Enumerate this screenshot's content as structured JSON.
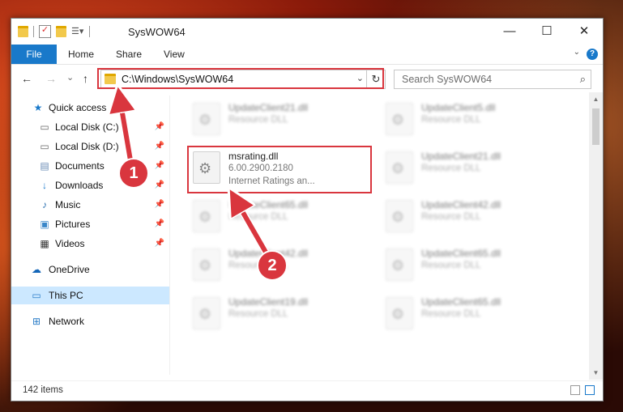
{
  "window": {
    "title": "SysWOW64",
    "minimize_glyph": "—",
    "maximize_glyph": "☐",
    "close_glyph": "✕"
  },
  "ribbon": {
    "tabs": [
      "File",
      "Home",
      "Share",
      "View"
    ],
    "help_glyph": "?"
  },
  "navbar": {
    "back_glyph": "←",
    "forward_glyph": "→",
    "recent_glyph": "⌄",
    "up_glyph": "↑",
    "address": "C:\\Windows\\SysWOW64",
    "search_placeholder": "Search SysWOW64"
  },
  "sidebar": {
    "items": [
      {
        "label": "Quick access",
        "icon": "star-icon"
      },
      {
        "label": "Local Disk (C:)",
        "icon": "drive-icon",
        "pinned": true
      },
      {
        "label": "Local Disk (D:)",
        "icon": "drive-icon",
        "pinned": true
      },
      {
        "label": "Documents",
        "icon": "documents-icon",
        "pinned": true
      },
      {
        "label": "Downloads",
        "icon": "download-icon",
        "pinned": true
      },
      {
        "label": "Music",
        "icon": "music-icon",
        "pinned": true
      },
      {
        "label": "Pictures",
        "icon": "pictures-icon",
        "pinned": true
      },
      {
        "label": "Videos",
        "icon": "videos-icon",
        "pinned": true
      },
      {
        "label": "OneDrive",
        "icon": "cloud-icon"
      },
      {
        "label": "This PC",
        "icon": "computer-icon",
        "selected": true
      },
      {
        "label": "Network",
        "icon": "network-icon"
      }
    ]
  },
  "files": {
    "highlighted": {
      "name": "msrating.dll",
      "version": "6.00.2900.2180",
      "description": "Internet Ratings an..."
    },
    "blurred": [
      {
        "name": "UpdateClient21.dll",
        "desc": "Resource DLL"
      },
      {
        "name": "UpdateClient5.dll",
        "desc": "Resource DLL"
      },
      {
        "name": "UpdateClient21.dll",
        "desc": "Resource DLL"
      },
      {
        "name": "UpdateClient65.dll",
        "desc": "Resource DLL"
      },
      {
        "name": "UpdateClient42.dll",
        "desc": "Resource DLL"
      },
      {
        "name": "UpdateClient42.dll",
        "desc": "Resource DLL"
      },
      {
        "name": "UpdateClient65.dll",
        "desc": "Resource DLL"
      },
      {
        "name": "UpdateClient19.dll",
        "desc": "Resource DLL"
      },
      {
        "name": "UpdateClient65.dll",
        "desc": "Resource DLL"
      }
    ]
  },
  "status": {
    "item_count": "142 items"
  },
  "callouts": [
    "1",
    "2"
  ],
  "colors": {
    "accent": "#1979ca",
    "highlight": "#d9363e",
    "selection": "#cce8ff"
  }
}
